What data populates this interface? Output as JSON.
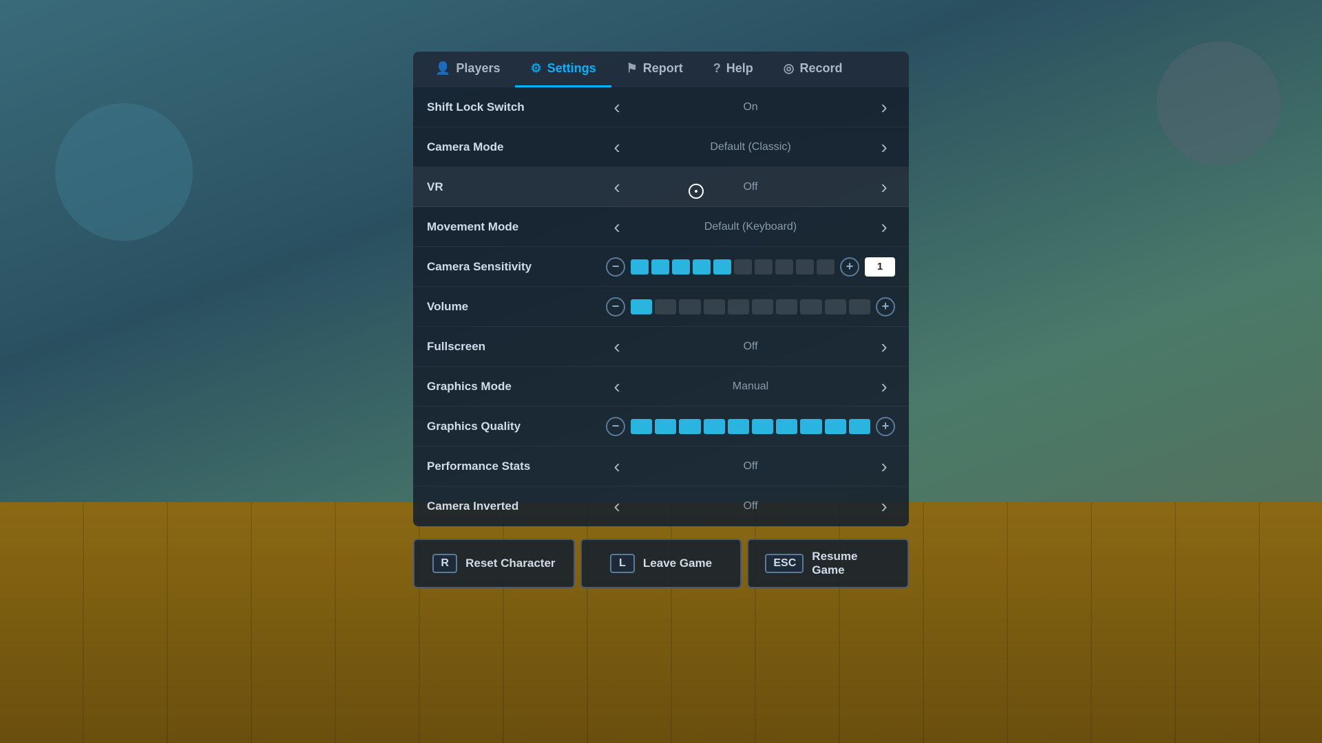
{
  "background": {
    "color": "#2a4a5e"
  },
  "tabs": [
    {
      "id": "players",
      "label": "Players",
      "icon": "👤",
      "active": false
    },
    {
      "id": "settings",
      "label": "Settings",
      "icon": "⚙️",
      "active": true
    },
    {
      "id": "report",
      "label": "Report",
      "icon": "🚩",
      "active": false
    },
    {
      "id": "help",
      "label": "Help",
      "icon": "❓",
      "active": false
    },
    {
      "id": "record",
      "label": "Record",
      "icon": "⊙",
      "active": false
    }
  ],
  "settings": [
    {
      "id": "shift-lock-switch",
      "label": "Shift Lock Switch",
      "type": "toggle",
      "value": "On"
    },
    {
      "id": "camera-mode",
      "label": "Camera Mode",
      "type": "toggle",
      "value": "Default (Classic)"
    },
    {
      "id": "vr",
      "label": "VR",
      "type": "toggle",
      "value": "Off",
      "highlighted": true
    },
    {
      "id": "movement-mode",
      "label": "Movement Mode",
      "type": "toggle",
      "value": "Default (Keyboard)"
    },
    {
      "id": "camera-sensitivity",
      "label": "Camera Sensitivity",
      "type": "slider",
      "filledSegments": 5,
      "totalSegments": 10,
      "numericValue": "1"
    },
    {
      "id": "volume",
      "label": "Volume",
      "type": "slider",
      "filledSegments": 1,
      "totalSegments": 10,
      "numericValue": null
    },
    {
      "id": "fullscreen",
      "label": "Fullscreen",
      "type": "toggle",
      "value": "Off"
    },
    {
      "id": "graphics-mode",
      "label": "Graphics Mode",
      "type": "toggle",
      "value": "Manual"
    },
    {
      "id": "graphics-quality",
      "label": "Graphics Quality",
      "type": "slider",
      "filledSegments": 10,
      "totalSegments": 10,
      "numericValue": null
    },
    {
      "id": "performance-stats",
      "label": "Performance Stats",
      "type": "toggle",
      "value": "Off"
    },
    {
      "id": "camera-inverted",
      "label": "Camera Inverted",
      "type": "toggle",
      "value": "Off"
    }
  ],
  "actions": [
    {
      "id": "reset-character",
      "key": "R",
      "label": "Reset Character"
    },
    {
      "id": "leave-game",
      "key": "L",
      "label": "Leave Game"
    },
    {
      "id": "resume-game",
      "key": "ESC",
      "label": "Resume Game"
    }
  ]
}
